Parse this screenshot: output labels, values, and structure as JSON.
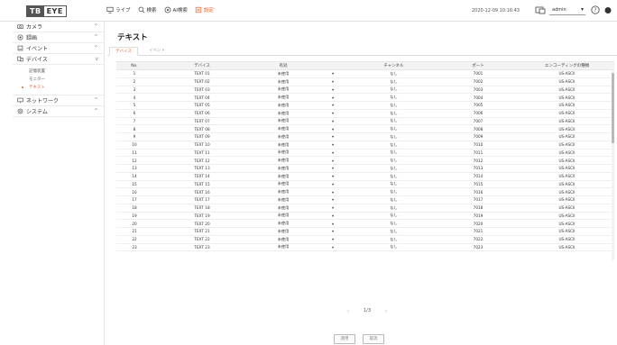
{
  "brand": {
    "logo_left": "TB",
    "logo_right": "EYE"
  },
  "topnav": [
    {
      "label": "ライブ",
      "icon": "monitor-icon"
    },
    {
      "label": "検索",
      "icon": "search-icon"
    },
    {
      "label": "AI検索",
      "icon": "ai-search-icon"
    },
    {
      "label": "設定",
      "icon": "settings-icon",
      "active": true
    }
  ],
  "header": {
    "datetime": "2020-12-09 10:16:43",
    "user": "admin"
  },
  "sidebar": {
    "items": [
      {
        "label": "カメラ",
        "icon": "camera-icon",
        "chevron": "^"
      },
      {
        "label": "録画",
        "icon": "record-icon",
        "chevron": "^"
      },
      {
        "label": "イベント",
        "icon": "event-icon",
        "chevron": "^"
      },
      {
        "label": "デバイス",
        "icon": "device-icon",
        "chevron": "v"
      }
    ],
    "sub_items": [
      {
        "label": "記憶装置"
      },
      {
        "label": "モニター"
      },
      {
        "label": "テキスト",
        "active": true
      }
    ],
    "items_after": [
      {
        "label": "ネットワーク",
        "icon": "network-icon",
        "chevron": "^"
      },
      {
        "label": "システム",
        "icon": "system-icon",
        "chevron": "^"
      }
    ]
  },
  "page": {
    "title": "テキスト",
    "tabs": [
      "デバイス",
      "イベント"
    ],
    "active_tab": 0
  },
  "table": {
    "columns": [
      "No.",
      "デバイス",
      "有効",
      "",
      "チャンネル",
      "ポート",
      "エンコーディングの種類"
    ],
    "rows": [
      [
        "1",
        "TEXT 01",
        "未使用",
        "▾",
        "なし",
        "7001",
        "US-ASCII"
      ],
      [
        "2",
        "TEXT 02",
        "未使用",
        "▾",
        "なし",
        "7002",
        "US-ASCII"
      ],
      [
        "3",
        "TEXT 03",
        "未使用",
        "▾",
        "なし",
        "7003",
        "US-ASCII"
      ],
      [
        "4",
        "TEXT 04",
        "未使用",
        "▾",
        "なし",
        "7004",
        "US-ASCII"
      ],
      [
        "5",
        "TEXT 05",
        "未使用",
        "▾",
        "なし",
        "7005",
        "US-ASCII"
      ],
      [
        "6",
        "TEXT 06",
        "未使用",
        "▾",
        "なし",
        "7006",
        "US-ASCII"
      ],
      [
        "7",
        "TEXT 07",
        "未使用",
        "▾",
        "なし",
        "7007",
        "US-ASCII"
      ],
      [
        "8",
        "TEXT 08",
        "未使用",
        "▾",
        "なし",
        "7008",
        "US-ASCII"
      ],
      [
        "9",
        "TEXT 09",
        "未使用",
        "▾",
        "なし",
        "7009",
        "US-ASCII"
      ],
      [
        "10",
        "TEXT 10",
        "未使用",
        "▾",
        "なし",
        "7010",
        "US-ASCII"
      ],
      [
        "11",
        "TEXT 11",
        "未使用",
        "▾",
        "なし",
        "7011",
        "US-ASCII"
      ],
      [
        "12",
        "TEXT 12",
        "未使用",
        "▾",
        "なし",
        "7012",
        "US-ASCII"
      ],
      [
        "13",
        "TEXT 13",
        "未使用",
        "▾",
        "なし",
        "7013",
        "US-ASCII"
      ],
      [
        "14",
        "TEXT 14",
        "未使用",
        "▾",
        "なし",
        "7014",
        "US-ASCII"
      ],
      [
        "15",
        "TEXT 15",
        "未使用",
        "▾",
        "なし",
        "7015",
        "US-ASCII"
      ],
      [
        "16",
        "TEXT 16",
        "未使用",
        "▾",
        "なし",
        "7016",
        "US-ASCII"
      ],
      [
        "17",
        "TEXT 17",
        "未使用",
        "▾",
        "なし",
        "7017",
        "US-ASCII"
      ],
      [
        "18",
        "TEXT 18",
        "未使用",
        "▾",
        "なし",
        "7018",
        "US-ASCII"
      ],
      [
        "19",
        "TEXT 19",
        "未使用",
        "▾",
        "なし",
        "7019",
        "US-ASCII"
      ],
      [
        "20",
        "TEXT 20",
        "未使用",
        "▾",
        "なし",
        "7020",
        "US-ASCII"
      ],
      [
        "21",
        "TEXT 21",
        "未使用",
        "▾",
        "なし",
        "7021",
        "US-ASCII"
      ],
      [
        "22",
        "TEXT 22",
        "未使用",
        "▾",
        "なし",
        "7022",
        "US-ASCII"
      ],
      [
        "23",
        "TEXT 23",
        "未使用",
        "▾",
        "なし",
        "7023",
        "US-ASCII"
      ]
    ]
  },
  "pager": {
    "prev": "‹",
    "label": "1/3",
    "next": "›"
  },
  "buttons": {
    "apply": "適用",
    "cancel": "取消"
  },
  "colors": {
    "accent": "#e8632b",
    "header_bg": "#f3f3f3"
  }
}
